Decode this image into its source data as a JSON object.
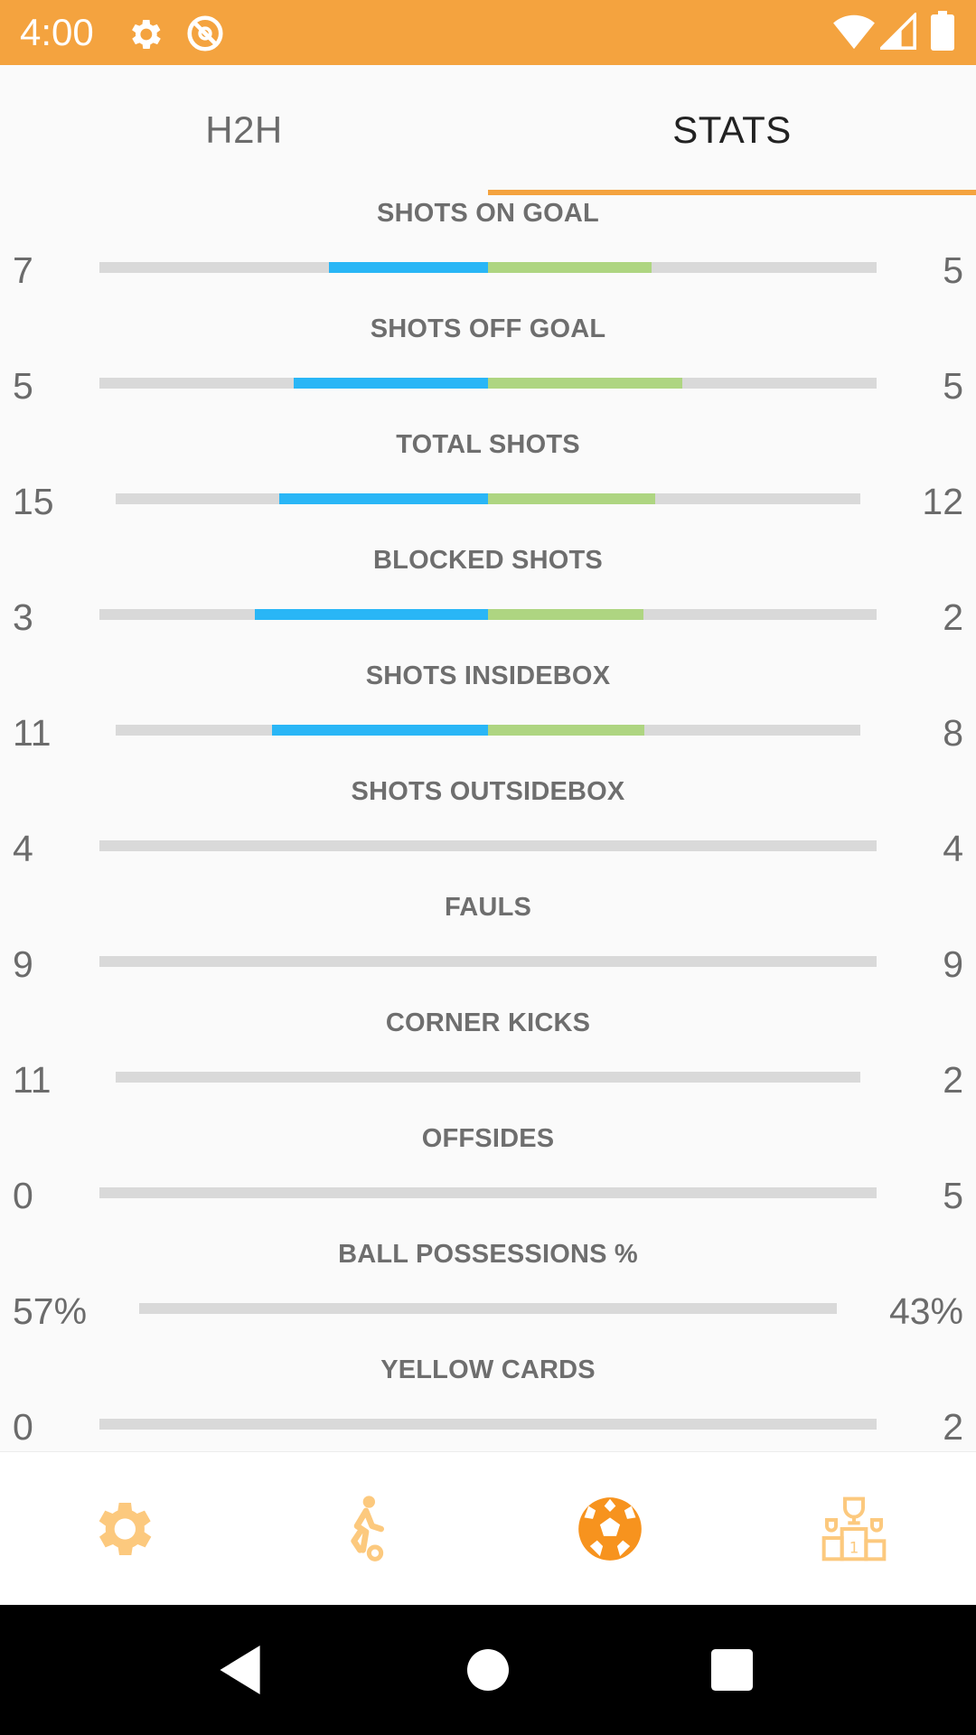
{
  "status_bar": {
    "time": "4:00",
    "icons": [
      "gear-icon",
      "do-not-disturb-icon",
      "wifi-icon",
      "cell-signal-icon",
      "battery-icon"
    ],
    "background": "#f4a33f"
  },
  "tabs": [
    {
      "label": "H2H",
      "active": false
    },
    {
      "label": "STATS",
      "active": true
    }
  ],
  "colors": {
    "accent": "#f4a33f",
    "home_bar": "#29b6f6",
    "away_bar": "#aed581",
    "track": "#d9d9d9"
  },
  "stats": [
    {
      "title": "SHOTS ON GOAL",
      "home": "7",
      "away": "5",
      "home_fill": 0.41,
      "away_fill": 0.42
    },
    {
      "title": "SHOTS OFF GOAL",
      "home": "5",
      "away": "5",
      "home_fill": 0.5,
      "away_fill": 0.5
    },
    {
      "title": "TOTAL SHOTS",
      "home": "15",
      "away": "12",
      "home_fill": 0.56,
      "away_fill": 0.45
    },
    {
      "title": "BLOCKED SHOTS",
      "home": "3",
      "away": "2",
      "home_fill": 0.6,
      "away_fill": 0.4
    },
    {
      "title": "SHOTS INSIDEBOX",
      "home": "11",
      "away": "8",
      "home_fill": 0.58,
      "away_fill": 0.42
    },
    {
      "title": "SHOTS OUTSIDEBOX",
      "home": "4",
      "away": "4",
      "home_fill": 0,
      "away_fill": 0
    },
    {
      "title": "FAULS",
      "home": "9",
      "away": "9",
      "home_fill": 0,
      "away_fill": 0
    },
    {
      "title": "CORNER KICKS",
      "home": "11",
      "away": "2",
      "home_fill": 0,
      "away_fill": 0
    },
    {
      "title": "OFFSIDES",
      "home": "0",
      "away": "5",
      "home_fill": 0,
      "away_fill": 0
    },
    {
      "title": "BALL POSSESSIONS %",
      "home": "57%",
      "away": "43%",
      "home_fill": 0,
      "away_fill": 0
    },
    {
      "title": "YELLOW CARDS",
      "home": "0",
      "away": "2",
      "home_fill": 0,
      "away_fill": 0
    }
  ],
  "bottom_nav": [
    {
      "icon": "settings-icon",
      "active": false
    },
    {
      "icon": "player-icon",
      "active": false
    },
    {
      "icon": "soccer-ball-icon",
      "active": true
    },
    {
      "icon": "trophy-podium-icon",
      "active": false
    }
  ],
  "system_nav": [
    "back-icon",
    "home-icon",
    "recents-icon"
  ]
}
